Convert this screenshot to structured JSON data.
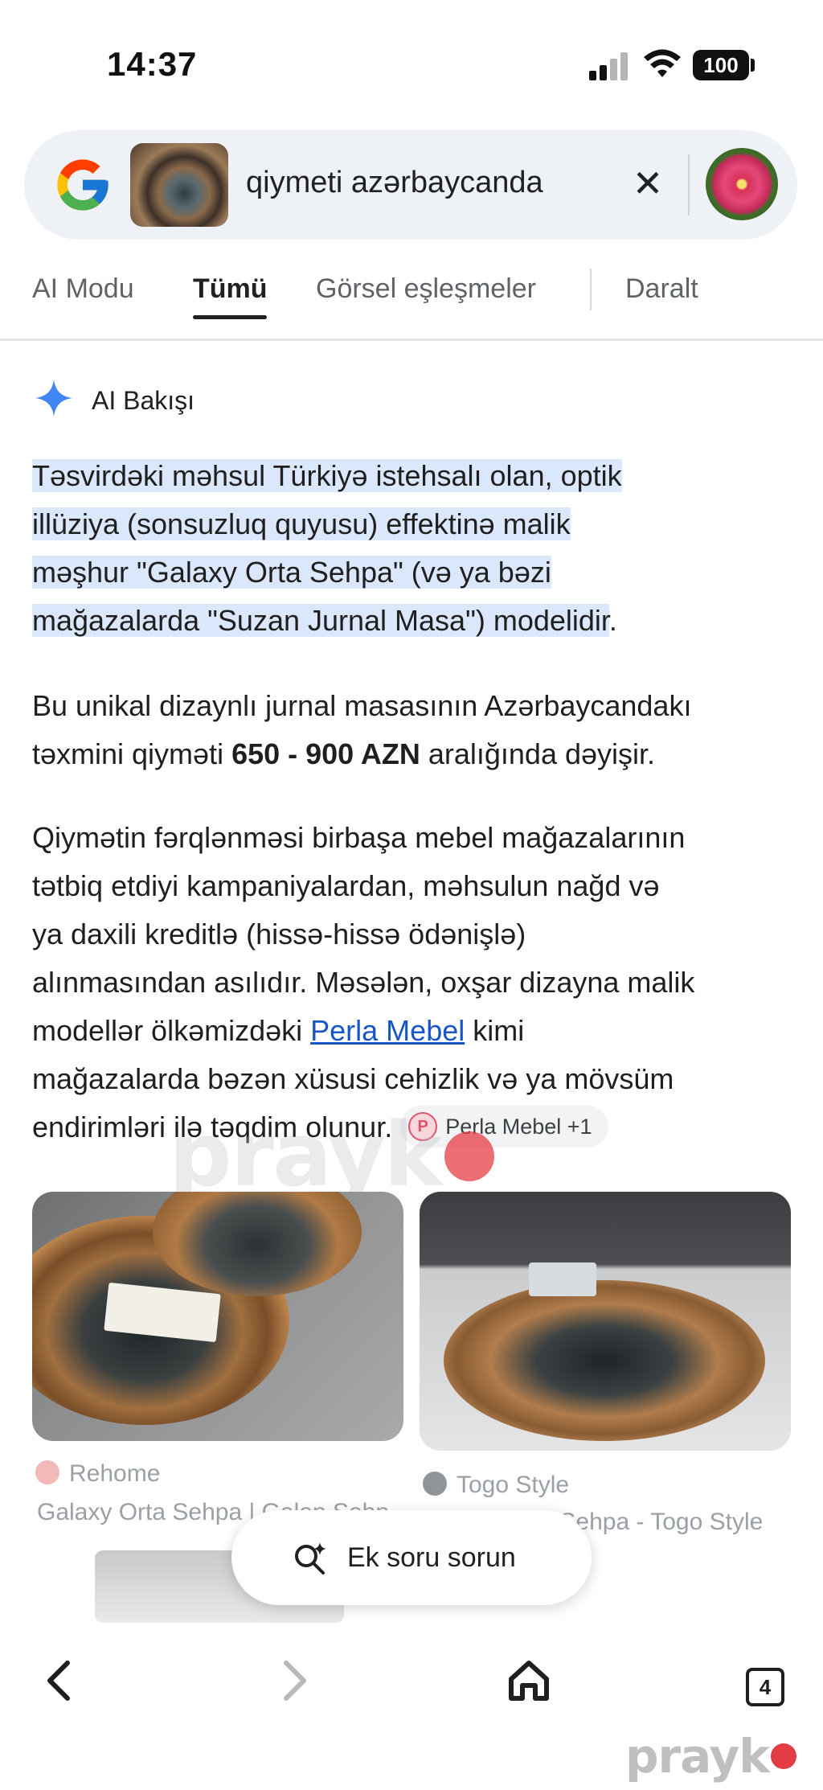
{
  "status_bar": {
    "time": "14:37",
    "battery": "100",
    "icons": [
      "signal-icon",
      "wifi-icon",
      "battery-icon"
    ]
  },
  "search": {
    "query": "qiymeti azərbaycanda",
    "logo": "google-g-logo",
    "clear_icon": "✕"
  },
  "tabs": [
    {
      "label": "AI Modu"
    },
    {
      "label": "Tümü",
      "active": true
    },
    {
      "label": "Görsel eşleşmeler"
    },
    {
      "label": "Daralt"
    }
  ],
  "ai_overview": {
    "title": "AI Bakışı",
    "p1_l1": "Təsvirdəki məhsul Türkiyə istehsalı olan, optik",
    "p1_l2": "illüziya (sonsuzluq quyusu) effektinə malik",
    "p1_l3": "məşhur \"Galaxy Orta Sehpa\" (və ya bəzi",
    "p1_l4": "mağazalarda \"Suzan Jurnal Masa\") modelidir",
    "p1_end": ".",
    "p2_a": "Bu unikal dizaynlı jurnal masasının Azərbaycandakı",
    "p2_b": "təxmini qiyməti ",
    "p2_bold": "650 - 900 AZN",
    "p2_c": " aralığında dəyişir.",
    "p3_l1": "Qiymətin fərqlənməsi birbaşa mebel mağazalarının",
    "p3_l2": "tətbiq etdiyi kampaniyalardan, məhsulun nağd və",
    "p3_l3": "ya daxili kreditlə (hissə-hissə ödənişlə)",
    "p3_l4": "alınmasından asılıdır. Məsələn, oxşar dizayna malik",
    "p3_l5a": "modellər ölkəmizdəki ",
    "p3_link": "Perla Mebel",
    "p3_l5b": " kimi",
    "p3_l6": "mağazalarda bəzən xüsusi cehizlik və ya mövsüm",
    "p3_l7": "endirimləri ilə təqdim olunur.",
    "chip_label": "Perla Mebel +1",
    "chip_icon_letter": "P"
  },
  "results": [
    {
      "source": "Rehome",
      "source_icon": "RH",
      "title": "Galaxy Orta Sehpa | Galen Sehpa"
    },
    {
      "source": "Togo Style",
      "source_icon": "T",
      "title": "Galaxy Orta Sehpa - Togo Style"
    }
  ],
  "ask_button": {
    "label": "Ek soru sorun"
  },
  "bottom_nav": {
    "tab_count": "4"
  },
  "watermark": {
    "text": "prayk"
  },
  "colors": {
    "highlight": "#dbe7fb",
    "link": "#1a55c8",
    "ai_sparkle": "#4285f4",
    "watermark_dot": "#e23c45"
  }
}
